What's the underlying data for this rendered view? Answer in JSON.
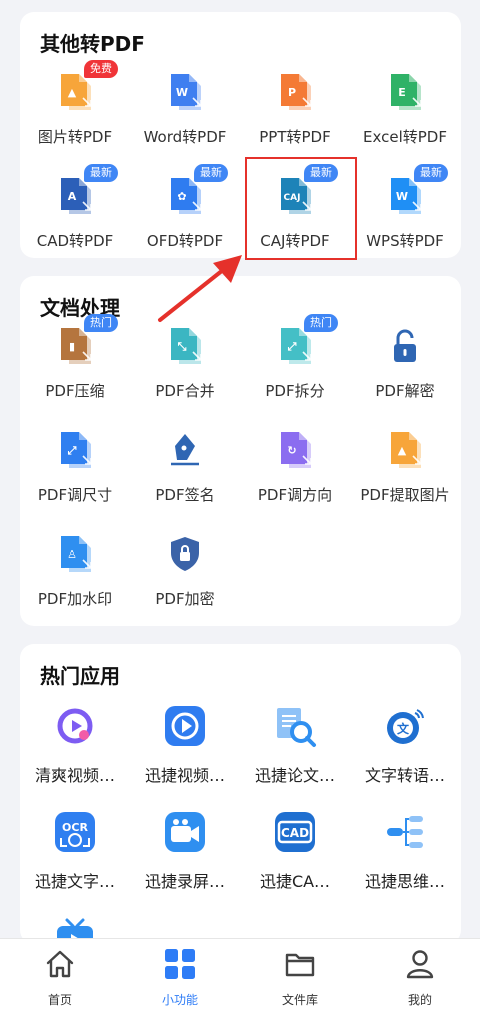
{
  "sections": {
    "convert": {
      "title": "其他转PDF",
      "items": [
        {
          "label": "图片转PDF",
          "icon": "image-file-icon",
          "color": "#f7a53a",
          "glyph": "▲",
          "badge": "免费",
          "badge_color": "red"
        },
        {
          "label": "Word转PDF",
          "icon": "word-file-icon",
          "color": "#3f7ff0",
          "glyph": "W",
          "badge": "",
          "badge_color": ""
        },
        {
          "label": "PPT转PDF",
          "icon": "ppt-file-icon",
          "color": "#f47a35",
          "glyph": "P",
          "badge": "",
          "badge_color": ""
        },
        {
          "label": "Excel转PDF",
          "icon": "excel-file-icon",
          "color": "#2fb267",
          "glyph": "E",
          "badge": "",
          "badge_color": ""
        },
        {
          "label": "CAD转PDF",
          "icon": "cad-file-icon",
          "color": "#2c5fb8",
          "glyph": "A",
          "badge": "最新",
          "badge_color": "blue"
        },
        {
          "label": "OFD转PDF",
          "icon": "ofd-file-icon",
          "color": "#2f7cf0",
          "glyph": "✿",
          "badge": "最新",
          "badge_color": "blue"
        },
        {
          "label": "CAJ转PDF",
          "icon": "caj-file-icon",
          "color": "#1d83b8",
          "glyph": "CAJ",
          "badge": "最新",
          "badge_color": "blue"
        },
        {
          "label": "WPS转PDF",
          "icon": "wps-file-icon",
          "color": "#1f8ff5",
          "glyph": "W",
          "badge": "最新",
          "badge_color": "blue"
        }
      ]
    },
    "docs": {
      "title": "文档处理",
      "items": [
        {
          "label": "PDF压缩",
          "icon": "zip-file-icon",
          "color": "#b5753e",
          "glyph": "▮",
          "badge": "热门",
          "badge_color": "blue"
        },
        {
          "label": "PDF合并",
          "icon": "merge-file-icon",
          "color": "#3bb6c2",
          "glyph": "⤡",
          "badge": "",
          "badge_color": ""
        },
        {
          "label": "PDF拆分",
          "icon": "split-file-icon",
          "color": "#44bfc6",
          "glyph": "⤢",
          "badge": "热门",
          "badge_color": "blue"
        },
        {
          "label": "PDF解密",
          "icon": "unlock-icon",
          "color": "#2f66b3",
          "glyph": "",
          "badge": "",
          "badge_color": ""
        },
        {
          "label": "PDF调尺寸",
          "icon": "resize-file-icon",
          "color": "#2f7ff0",
          "glyph": "⤢",
          "badge": "",
          "badge_color": ""
        },
        {
          "label": "PDF签名",
          "icon": "pen-sign-icon",
          "color": "#2f66b3",
          "glyph": "",
          "badge": "",
          "badge_color": ""
        },
        {
          "label": "PDF调方向",
          "icon": "rotate-file-icon",
          "color": "#8b6df0",
          "glyph": "↻",
          "badge": "",
          "badge_color": ""
        },
        {
          "label": "PDF提取图片",
          "icon": "extract-image-icon",
          "color": "#f7a53a",
          "glyph": "▲",
          "badge": "",
          "badge_color": ""
        },
        {
          "label": "PDF加水印",
          "icon": "watermark-file-icon",
          "color": "#2f8ff0",
          "glyph": "♙",
          "badge": "",
          "badge_color": ""
        },
        {
          "label": "PDF加密",
          "icon": "shield-lock-icon",
          "color": "#3b63a8",
          "glyph": "",
          "badge": "",
          "badge_color": ""
        }
      ]
    },
    "apps": {
      "title": "热门应用",
      "items": [
        {
          "label": "清爽视频…",
          "icon": "video-app-icon",
          "color": "#7d5cf2"
        },
        {
          "label": "迅捷视频…",
          "icon": "video-editor-icon",
          "color": "#2f7cf0"
        },
        {
          "label": "迅捷论文…",
          "icon": "paper-search-icon",
          "color": "#2f8ff0"
        },
        {
          "label": "文字转语…",
          "icon": "text-to-speech-icon",
          "color": "#1f6fd0"
        },
        {
          "label": "迅捷文字…",
          "icon": "ocr-icon",
          "color": "#2f7ff0"
        },
        {
          "label": "迅捷录屏…",
          "icon": "screen-record-icon",
          "color": "#2f8ff0"
        },
        {
          "label": "迅捷CA…",
          "icon": "cad-app-icon",
          "color": "#1f6fd0"
        },
        {
          "label": "迅捷思维…",
          "icon": "mindmap-icon",
          "color": "#2f8ff0"
        },
        {
          "label": "",
          "icon": "tv-app-icon",
          "color": "#2f8ff0"
        }
      ],
      "ocr_text": "OCR",
      "cad_text": "CAD",
      "wen_text": "文"
    }
  },
  "tabs": [
    {
      "label": "首页",
      "icon": "home-icon",
      "active": false
    },
    {
      "label": "小功能",
      "icon": "grid-icon",
      "active": true
    },
    {
      "label": "文件库",
      "icon": "folder-icon",
      "active": false
    },
    {
      "label": "我的",
      "icon": "profile-icon",
      "active": false
    }
  ],
  "colors": {
    "accent": "#2e7cf6",
    "highlight": "#e5312b"
  }
}
